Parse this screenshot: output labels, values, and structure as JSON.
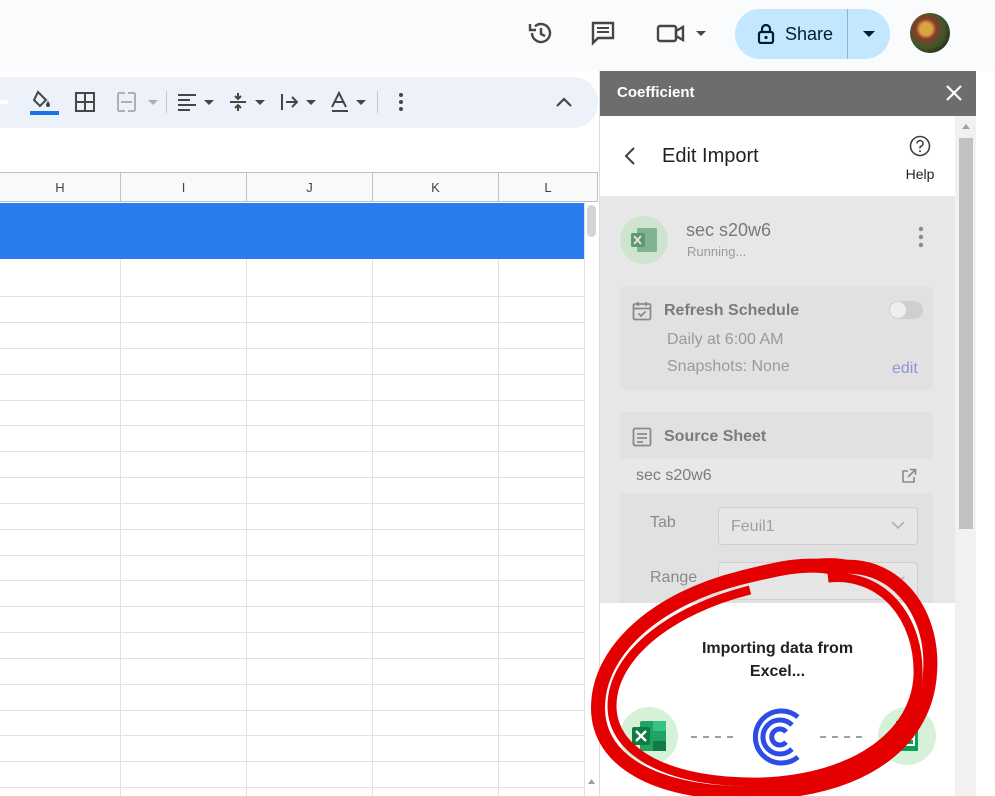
{
  "topbar": {
    "share_label": "Share",
    "icons": [
      "history-icon",
      "comment-icon",
      "video-call-icon",
      "lock-icon",
      "avatar"
    ]
  },
  "toolbar": {
    "icons": [
      "fill-color-icon",
      "borders-icon",
      "merge-cells-icon",
      "align-icon",
      "vertical-align-icon",
      "text-wrap-icon",
      "text-rotation-icon",
      "more-icon",
      "collapse-icon"
    ],
    "accent_color": "#1a73e8"
  },
  "sheet": {
    "columns": [
      "H",
      "I",
      "J",
      "K",
      "L"
    ],
    "selected_row_color": "#2b7cee"
  },
  "panel": {
    "title": "Coefficient",
    "nav_title": "Edit Import",
    "help_label": "Help",
    "source": {
      "name": "sec s20w6",
      "status": "Running..."
    },
    "refresh": {
      "title": "Refresh Schedule",
      "schedule": "Daily at 6:00 AM",
      "snapshots": "Snapshots: None",
      "edit_label": "edit"
    },
    "source_sheet": {
      "title": "Source Sheet",
      "sheet_name": "sec s20w6",
      "tab_label": "Tab",
      "tab_value": "Feuil1",
      "range_label": "Range"
    },
    "overlay": {
      "message": "Importing data from Excel...",
      "icons": [
        "excel-icon",
        "coefficient-logo-icon",
        "google-sheets-icon"
      ]
    }
  }
}
